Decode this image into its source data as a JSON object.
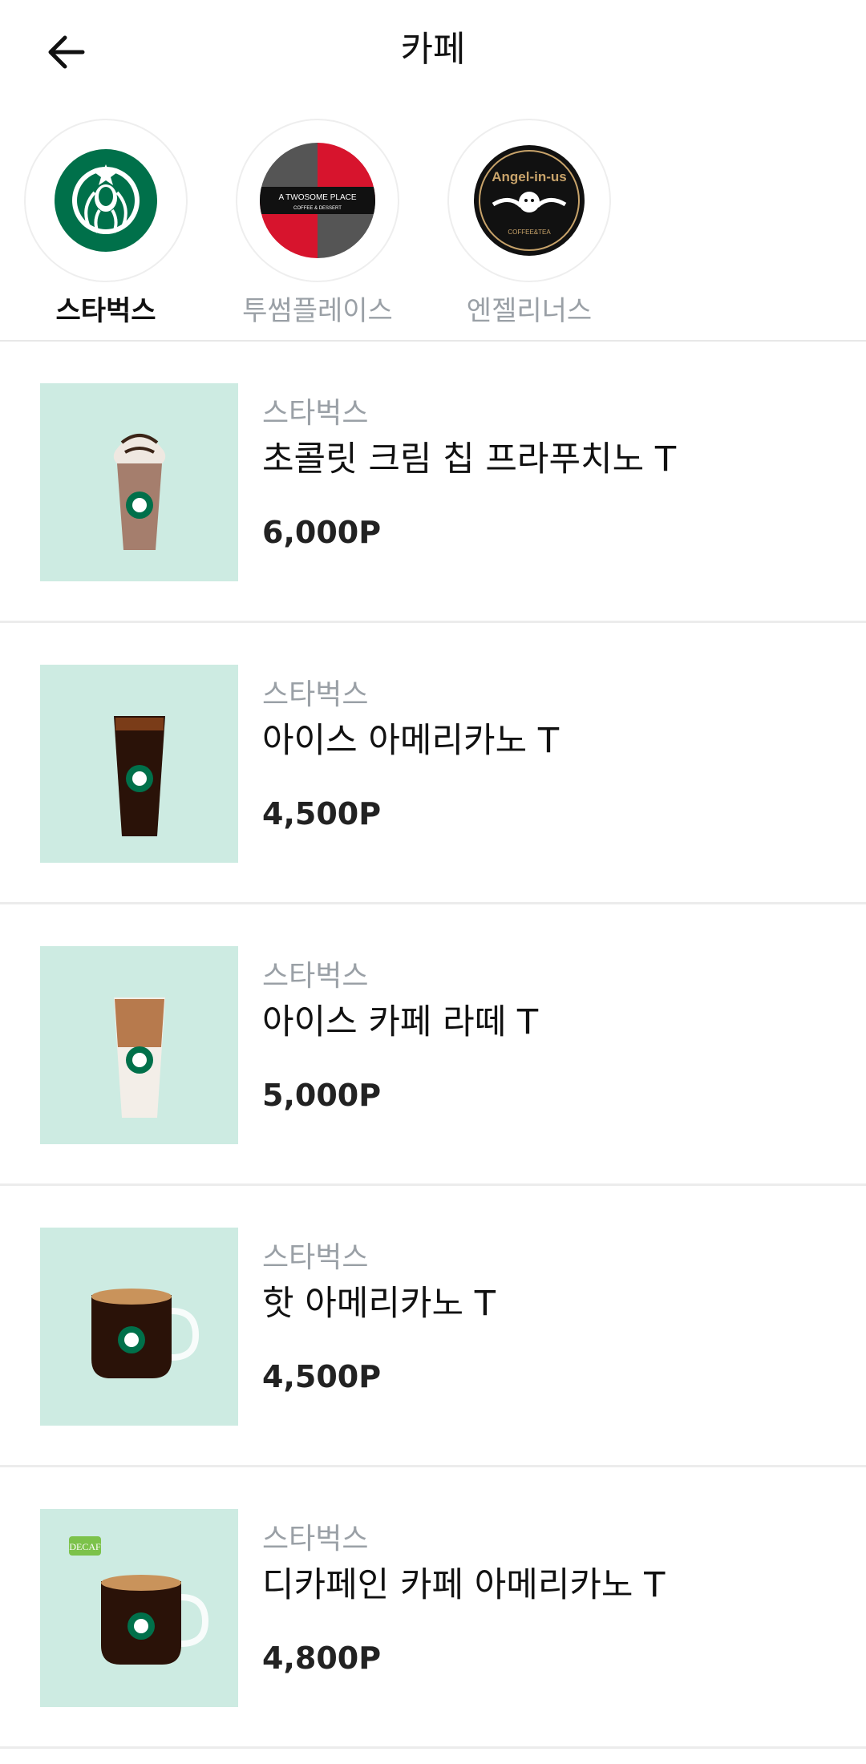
{
  "header": {
    "title": "카페"
  },
  "brands": [
    {
      "label": "스타벅스",
      "active": true
    },
    {
      "label": "투썸플레이스",
      "active": false,
      "logo_text": "A TWOSOME PLACE",
      "logo_subtext": "COFFEE & DESSERT"
    },
    {
      "label": "엔젤리너스",
      "active": false,
      "logo_text": "Angel-in-us",
      "logo_subtext": "COFFEE&TEA"
    }
  ],
  "products": [
    {
      "brand": "스타벅스",
      "name": "초콜릿 크림 칩 프라푸치노 T",
      "price": "6,000P"
    },
    {
      "brand": "스타벅스",
      "name": "아이스 아메리카노 T",
      "price": "4,500P"
    },
    {
      "brand": "스타벅스",
      "name": "아이스 카페 라떼 T",
      "price": "5,000P"
    },
    {
      "brand": "스타벅스",
      "name": "핫 아메리카노 T",
      "price": "4,500P"
    },
    {
      "brand": "스타벅스",
      "name": "디카페인 카페 아메리카노 T",
      "price": "4,800P",
      "badge": "DECAF"
    }
  ],
  "colors": {
    "thumb_bg": "#cdebe2",
    "starbucks_green": "#00704a",
    "twosome_red": "#d7142d",
    "twosome_gray": "#555555"
  }
}
